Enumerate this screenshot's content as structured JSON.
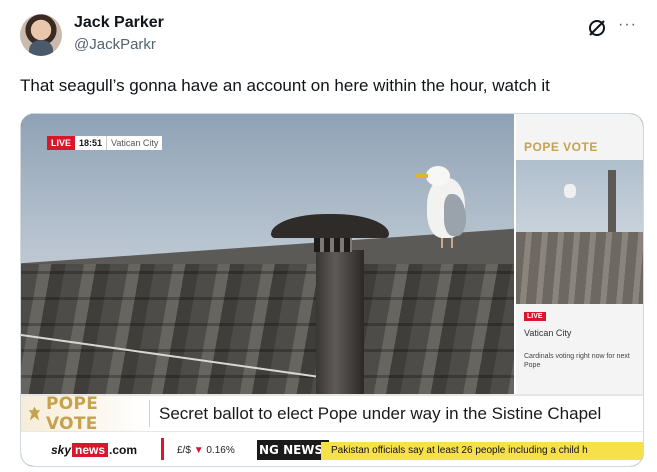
{
  "tweet": {
    "author_name": "Jack Parker",
    "author_handle": "@JackParkr",
    "text": "That seagull’s gonna have an account on here within the hour, watch it",
    "more_icon": "more-horizontal-icon",
    "grok_icon": "grok-icon"
  },
  "broadcast": {
    "live_label": "LIVE",
    "time": "18:51",
    "location": "Vatican City",
    "side_panel": {
      "title": "POPE VOTE",
      "live_label": "LIVE",
      "location": "Vatican City",
      "caption": "Cardinals voting right now for next Pope"
    },
    "lower_third": {
      "title": "POPE VOTE",
      "headline": "Secret ballot to elect Pope under way in the Sistine Chapel"
    },
    "ticker": {
      "sky": "sky",
      "news": "news",
      "com": ".com",
      "currency_pair": "£/$",
      "currency_change": "0.16%",
      "breaking_label": "NG NEWS",
      "ticker_text": "Pakistan officials say at least 26 people including a child h"
    }
  },
  "colors": {
    "live_red": "#d8172b",
    "gold": "#c6a14e",
    "ticker_yellow": "#f7e14a"
  }
}
